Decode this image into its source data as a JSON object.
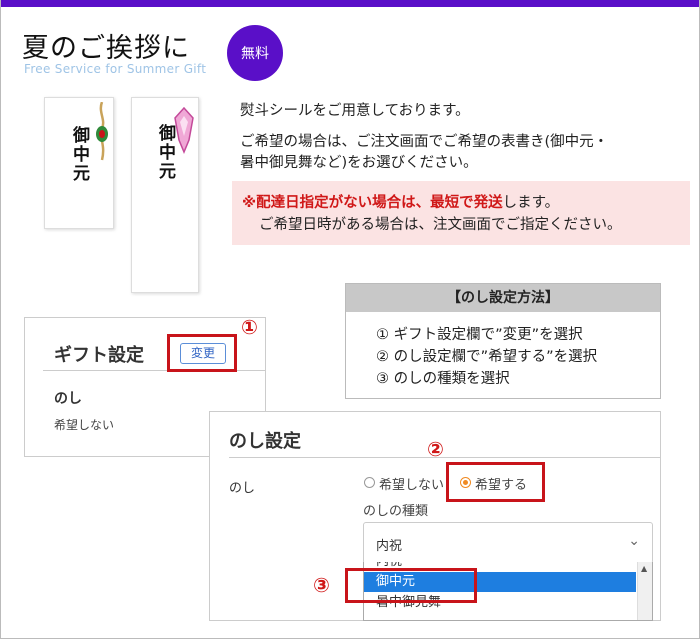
{
  "header": {
    "title": "夏のご挨拶に",
    "subtitle": "Free Service for Summer Gift",
    "badge": "無料"
  },
  "colors": {
    "brand": "#5a0fc8",
    "alert": "#d01818",
    "highlight": "#c8141a",
    "selected": "#1e7ee0",
    "radio_on": "#f08a22"
  },
  "tags": [
    {
      "text": "御中元",
      "decoration": "mizuhiki-knot"
    },
    {
      "text": "御中元",
      "decoration": "pink-ornament"
    }
  ],
  "description": {
    "line1": "熨斗シールをご用意しております。",
    "line2": "ご希望の場合は、ご注文画面でご希望の表書き(御中元・",
    "line3": "暑中御見舞など)をお選びください。"
  },
  "notice": {
    "mark": "※",
    "alert_text": "配達日指定がない場合は、最短で発送",
    "rest": "します。",
    "line2": "ご希望日時がある場合は、注文画面でご指定ください。"
  },
  "howto": {
    "title": "【のし設定方法】",
    "steps": [
      "① ギフト設定欄で”変更”を選択",
      "② のし設定欄で”希望する”を選択",
      "③ のしの種類を選択"
    ]
  },
  "gift_panel": {
    "title": "ギフト設定",
    "change_button": "変更",
    "noshi_label": "のし",
    "noshi_value": "希望しない"
  },
  "noshi_panel": {
    "title": "のし設定",
    "field_label": "のし",
    "radio_options": [
      "希望しない",
      "希望する"
    ],
    "selected_radio": 1,
    "kind_label": "のしの種類",
    "select_value": "内祝",
    "list_items": [
      "内祝",
      "御中元",
      "暑中御見舞"
    ],
    "selected_item": 1
  },
  "markers": [
    "①",
    "②",
    "③"
  ]
}
